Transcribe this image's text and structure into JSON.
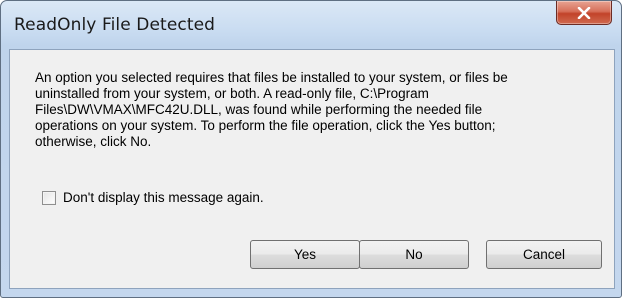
{
  "window": {
    "title": "ReadOnly File Detected"
  },
  "message": {
    "lines": [
      "An option you selected requires that files be installed to your system, or files be",
      "uninstalled from your system, or both. A read-only file, C:\\Program",
      "Files\\DW\\VMAX\\MFC42U.DLL, was found while performing the needed file",
      "operations on your system. To perform the file operation, click the Yes button;",
      "otherwise, click No."
    ]
  },
  "checkbox": {
    "label": "Don't display this message again.",
    "checked": false
  },
  "buttons": {
    "yes": "Yes",
    "no": "No",
    "cancel": "Cancel"
  },
  "icons": {
    "close": "close-icon"
  },
  "colors": {
    "close_button": "#c7462d",
    "frame": "#c4d7ee",
    "client_background": "#f0f0f0"
  }
}
